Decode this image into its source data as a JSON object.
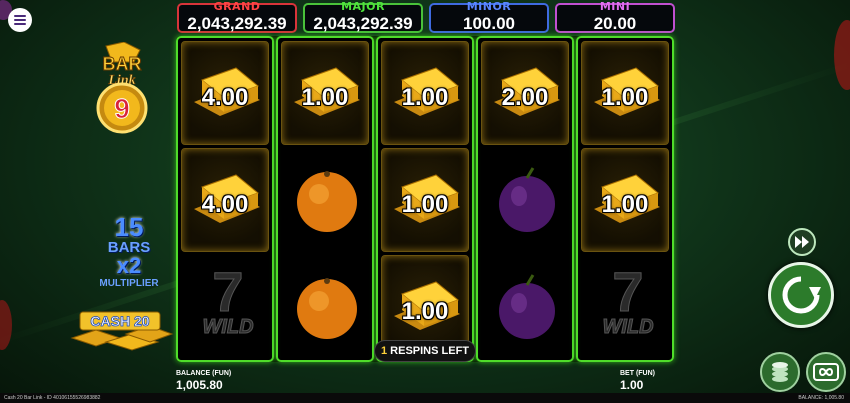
{
  "jackpots": {
    "grand": {
      "label": "GRAND",
      "value": "2,043,292.39"
    },
    "major": {
      "label": "MAJOR",
      "value": "2,043,292.39"
    },
    "minor": {
      "label": "MINOR",
      "value": "100.00"
    },
    "mini": {
      "label": "MINI",
      "value": "20.00"
    }
  },
  "logo": {
    "line1": "BAR",
    "line2": "Link",
    "number": "9"
  },
  "bars_counter": {
    "count": "15",
    "label": "BARS",
    "multiplier": "x2",
    "multiplier_label": "MULTIPLIER"
  },
  "cash_label": "CASH 20",
  "reels": [
    [
      {
        "type": "gold",
        "value": "4.00"
      },
      {
        "type": "gold",
        "value": "4.00"
      },
      {
        "type": "wild",
        "label": "WILD",
        "digit": "7"
      }
    ],
    [
      {
        "type": "gold",
        "value": "1.00"
      },
      {
        "type": "orange"
      },
      {
        "type": "orange"
      }
    ],
    [
      {
        "type": "gold",
        "value": "1.00"
      },
      {
        "type": "gold",
        "value": "1.00"
      },
      {
        "type": "gold",
        "value": "1.00"
      }
    ],
    [
      {
        "type": "gold",
        "value": "2.00"
      },
      {
        "type": "plum"
      },
      {
        "type": "plum"
      }
    ],
    [
      {
        "type": "gold",
        "value": "1.00"
      },
      {
        "type": "gold",
        "value": "1.00"
      },
      {
        "type": "wild",
        "label": "WILD",
        "digit": "7"
      }
    ]
  ],
  "respins": {
    "count": "1",
    "label": "RESPINS LEFT"
  },
  "balance": {
    "label": "BALANCE (FUN)",
    "value": "1,005.80"
  },
  "bet": {
    "label": "BET (FUN)",
    "value": "1.00"
  },
  "footer": {
    "left": "Cash 20 Bar Link - ID 40106155526983882",
    "right": "BALANCE: 1,005.80"
  },
  "colors": {
    "reel_border": "#4fdc2a",
    "spin_button": "#2c7b2b",
    "gold": "#f2b81c"
  },
  "icons": {
    "menu": "menu-icon",
    "turbo": "fast-forward-icon",
    "spin": "refresh-icon",
    "coins": "coin-stack-icon",
    "autoplay": "infinity-icon"
  }
}
